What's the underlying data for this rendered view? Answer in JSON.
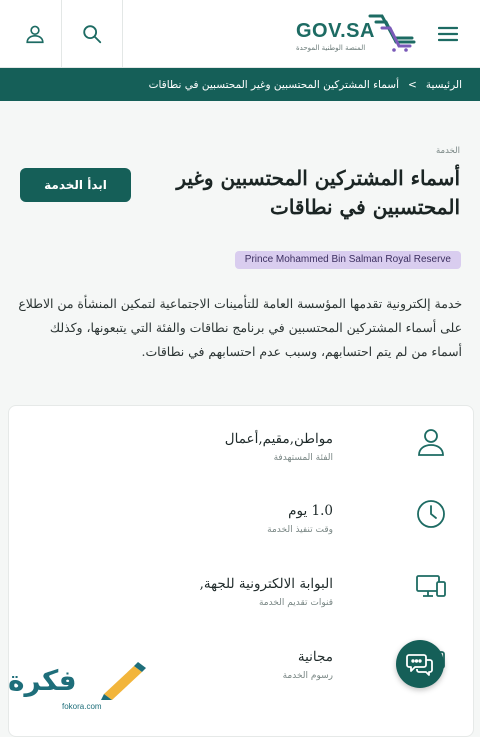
{
  "header": {
    "logo_title": "GOV.SA",
    "logo_subtitle": "المنصة الوطنية الموحدة",
    "icons": {
      "user": "user-icon",
      "search": "search-icon",
      "menu": "hamburger-menu-icon"
    }
  },
  "breadcrumb": {
    "home": "الرئيسية",
    "separator": ">",
    "current": "أسماء المشتركين المحتسبين وغير المحتسبين في نطاقات"
  },
  "service": {
    "section_label": "الخدمة",
    "title": "أسماء المشتركين المحتسبين وغير المحتسبين في نطاقات",
    "start_button": "ابدأ الخدمة",
    "tag": "Prince Mohammed Bin Salman Royal Reserve",
    "description": "خدمة إلكترونية تقدمها المؤسسة العامة للتأمينات الاجتماعية لتمكين المنشأة من الاطلاع على أسماء المشتركين المحتسبين في برنامج نطاقات والفئة التي يتبعونها، وكذلك أسماء من لم يتم احتسابهم، وسبب عدم احتسابهم في نطاقات."
  },
  "details": [
    {
      "icon": "user-icon",
      "value": "مواطن,مقيم,أعمال",
      "label": "الفئة المستهدفة"
    },
    {
      "icon": "clock-icon",
      "value": "1.0 يوم",
      "label": "وقت تنفيذ الخدمة"
    },
    {
      "icon": "devices-icon",
      "value": "البوابة الالكترونية للجهة,",
      "label": "قنوات تقديم الخدمة"
    },
    {
      "icon": "fees-icon",
      "value": "مجانية",
      "label": "رسوم الخدمة"
    }
  ],
  "chat": {
    "icon": "chat-icon"
  },
  "watermark": {
    "text": "فكرة",
    "url": "fokora.com"
  },
  "colors": {
    "primary": "#155f58",
    "tag_bg": "#d9cdef",
    "page_bg": "#f5f7f6"
  }
}
